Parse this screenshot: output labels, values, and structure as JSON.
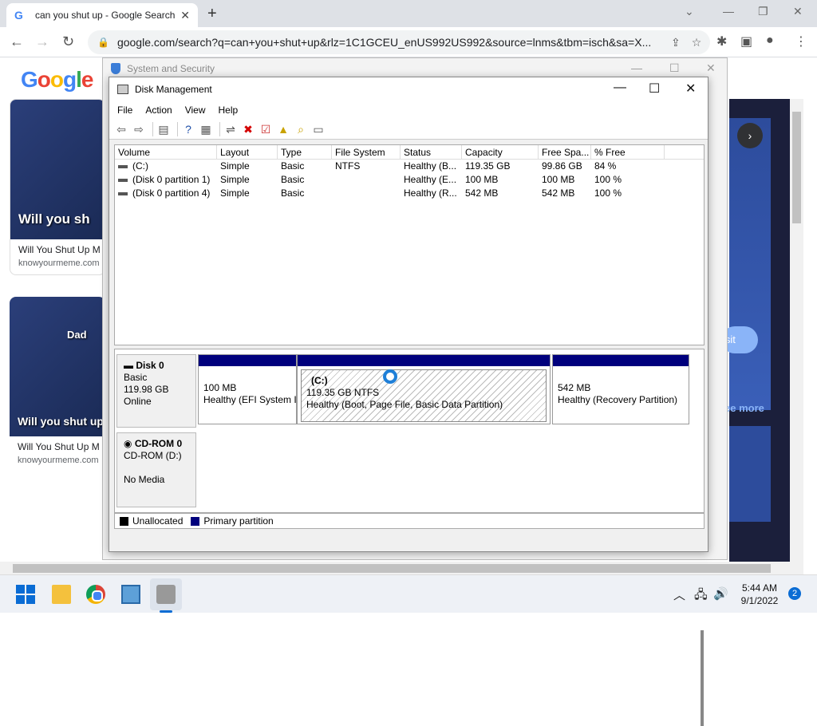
{
  "browser": {
    "tab_title": "can you shut up - Google Search",
    "url": "google.com/search?q=can+you+shut+up&rlz=1C1GCEU_enUS992US992&source=lnms&tbm=isch&sa=X...",
    "new_tab": "+",
    "close_tab": "✕"
  },
  "google": {
    "logo_letters": [
      "G",
      "o",
      "o",
      "g",
      "l",
      "e"
    ],
    "results": [
      {
        "caption": "Will you sh",
        "title": "Will You Shut Up M",
        "source": "knowyourmeme.com"
      },
      {
        "caption": "Will you shut up",
        "overlay": "Dad",
        "title": "Will You Shut Up M",
        "source": "knowyourmeme.com"
      }
    ],
    "right_panel": {
      "visit": "isit",
      "see_more": "ee more"
    }
  },
  "system_window": {
    "title": "System and Security"
  },
  "disk_management": {
    "title": "Disk Management",
    "menu": [
      "File",
      "Action",
      "View",
      "Help"
    ],
    "columns": [
      "Volume",
      "Layout",
      "Type",
      "File System",
      "Status",
      "Capacity",
      "Free Spa...",
      "% Free"
    ],
    "volumes": [
      [
        "(C:)",
        "Simple",
        "Basic",
        "NTFS",
        "Healthy (B...",
        "119.35 GB",
        "99.86 GB",
        "84 %"
      ],
      [
        "(Disk 0 partition 1)",
        "Simple",
        "Basic",
        "",
        "Healthy (E...",
        "100 MB",
        "100 MB",
        "100 %"
      ],
      [
        "(Disk 0 partition 4)",
        "Simple",
        "Basic",
        "",
        "Healthy (R...",
        "542 MB",
        "542 MB",
        "100 %"
      ]
    ],
    "disk0": {
      "name": "Disk 0",
      "type": "Basic",
      "size": "119.98 GB",
      "status": "Online",
      "partitions": [
        {
          "label": "",
          "size": "100 MB",
          "status": "Healthy (EFI System I"
        },
        {
          "label": "(C:)",
          "size": "119.35 GB NTFS",
          "status": "Healthy (Boot, Page File, Basic Data Partition)"
        },
        {
          "label": "",
          "size": "542 MB",
          "status": "Healthy (Recovery Partition)"
        }
      ]
    },
    "cdrom": {
      "name": "CD-ROM 0",
      "drive": "CD-ROM (D:)",
      "media": "No Media"
    },
    "legend": [
      {
        "label": "Unallocated",
        "color": "#000000"
      },
      {
        "label": "Primary partition",
        "color": "#00007d"
      }
    ]
  },
  "taskbar": {
    "time": "5:44 AM",
    "date": "9/1/2022",
    "notifications": "2"
  }
}
